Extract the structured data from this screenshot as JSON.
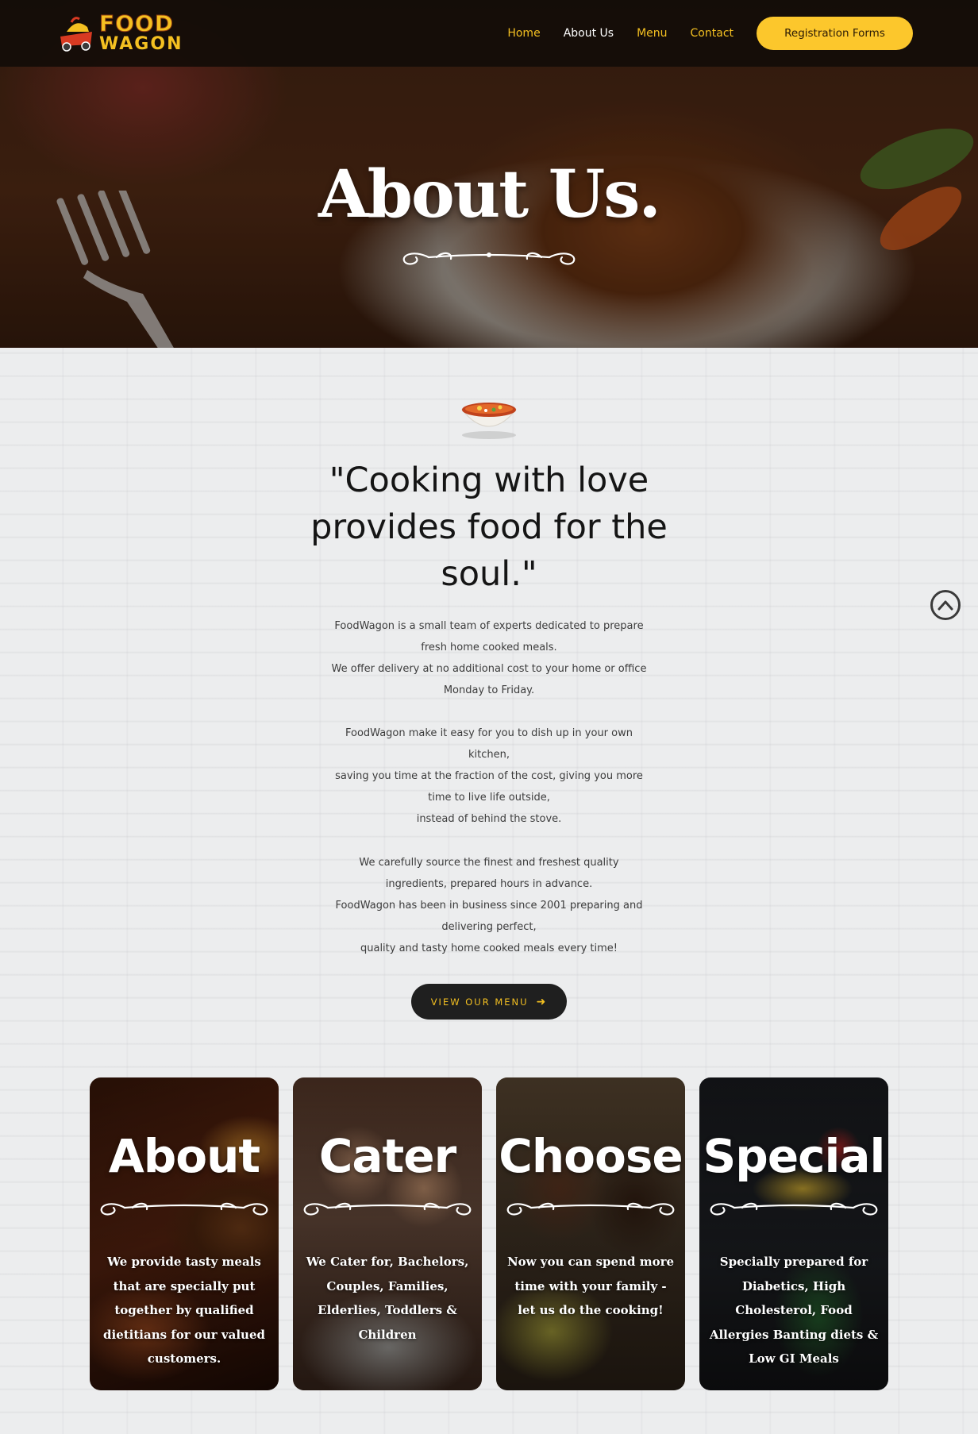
{
  "nav": {
    "logo_line1": "FOOD",
    "logo_line2": "WAGON",
    "links": [
      "Home",
      "About Us",
      "Menu",
      "Contact"
    ],
    "active_link": "About Us",
    "cta": "Registration Forms"
  },
  "hero": {
    "title": "About Us."
  },
  "intro": {
    "quote": "\"Cooking with love provides food for the soul.\"",
    "paragraph1": [
      "FoodWagon is a small team of experts dedicated to prepare",
      "fresh home cooked meals.",
      "We offer delivery at no additional cost to your home or office",
      "Monday to Friday."
    ],
    "paragraph2": [
      "FoodWagon make it easy for you to dish up in your own",
      "kitchen,",
      "saving you time at the fraction of the cost, giving you more",
      "time to live life outside,",
      "instead of behind the stove."
    ],
    "paragraph3": [
      "We carefully source the finest and freshest quality",
      "ingredients, prepared hours in advance.",
      "FoodWagon has been in business since 2001 preparing and",
      "delivering perfect,",
      "quality and tasty home cooked meals every time!"
    ],
    "button": "VIEW OUR MENU"
  },
  "cards": [
    {
      "title": "About",
      "text": "We provide tasty meals that are specially put together by qualified dietitians for our valued customers."
    },
    {
      "title": "Cater",
      "text": "We Cater for, Bachelors, Couples, Families, Elderlies, Toddlers & Children"
    },
    {
      "title": "Choose",
      "text": "Now you can spend more time with your family - let us do the cooking!"
    },
    {
      "title": "Special",
      "text": "Specially prepared for Diabetics, High Cholesterol, Food Allergies Banting diets & Low GI Meals"
    }
  ],
  "colors": {
    "accent": "#f4c021",
    "button_dark": "#1f1f1f",
    "cta_bg": "#fcc72c"
  },
  "icons": {
    "scroll_top": "chevron-up-circle-icon",
    "menu_arrow": "arrow-right-icon",
    "section_icon": "soup-bowl-icon"
  }
}
